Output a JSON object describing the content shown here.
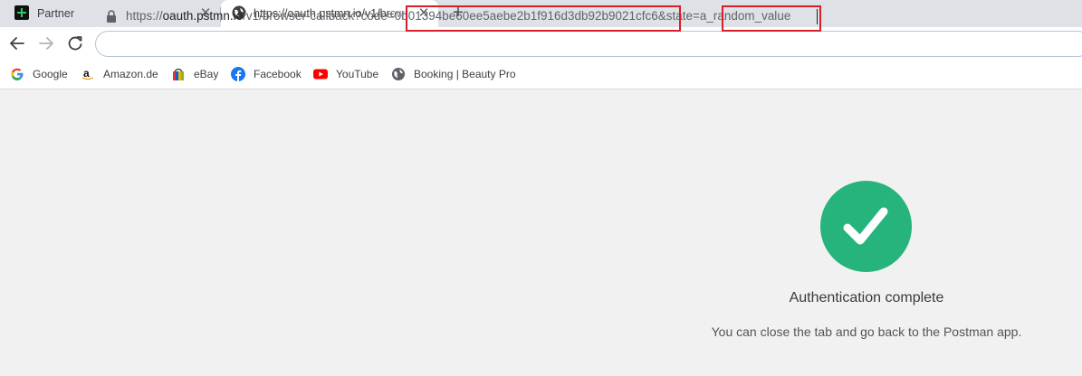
{
  "tabs": [
    {
      "title": "Partner",
      "active": false,
      "icon": "plus-square-icon"
    },
    {
      "title": "https://oauth.pstmn.io/v1/browser-callback",
      "active": true,
      "icon": "globe-icon"
    }
  ],
  "address_bar": {
    "url_scheme": "https://",
    "url_host": "oauth.pstmn.io",
    "url_path": "/v1/browser-callback?code=",
    "code_value": "0b01394be60ee5aebe2b1f916d3db92b9021cfc6",
    "state_sep": "&state=",
    "state_value": "a_random_value",
    "highlight_color": "#d81e28"
  },
  "bookmarks": [
    {
      "label": "Google",
      "icon": "google-icon"
    },
    {
      "label": "Amazon.de",
      "icon": "amazon-icon"
    },
    {
      "label": "eBay",
      "icon": "ebay-icon"
    },
    {
      "label": "Facebook",
      "icon": "facebook-icon"
    },
    {
      "label": "YouTube",
      "icon": "youtube-icon"
    },
    {
      "label": "Booking | Beauty Pro",
      "icon": "globe-icon"
    }
  ],
  "page": {
    "title": "Authentication complete",
    "message": "You can close the tab and go back to the Postman app.",
    "success_color": "#26b47c"
  }
}
